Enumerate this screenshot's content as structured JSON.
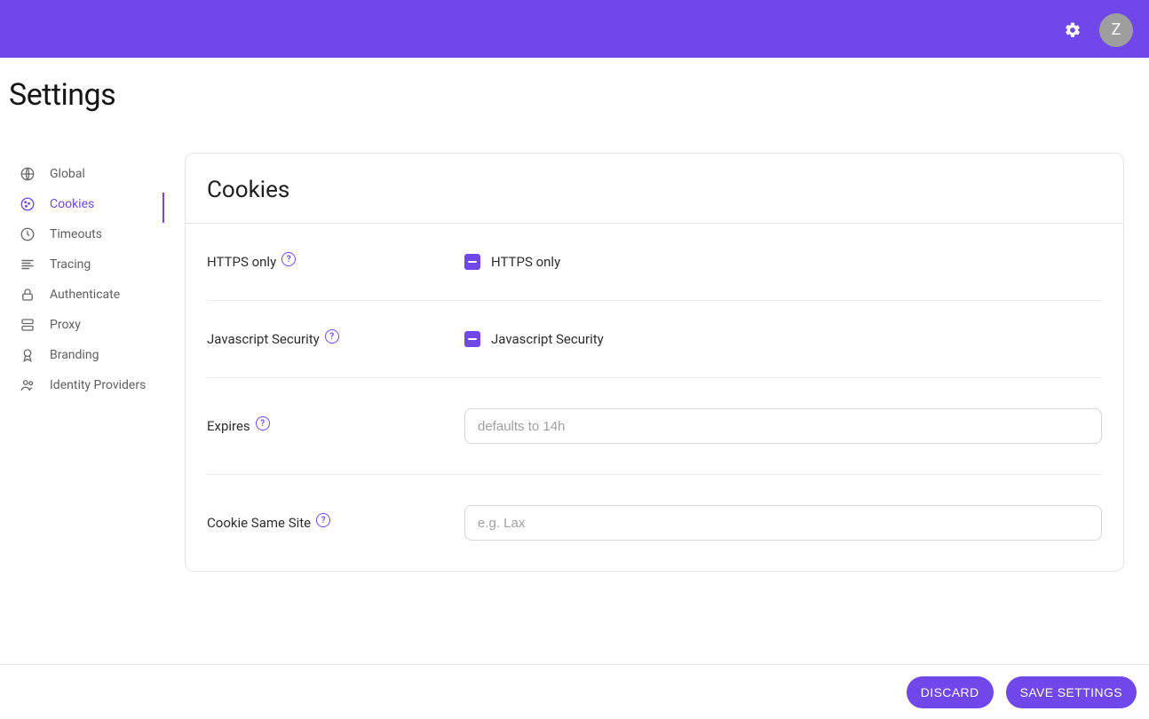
{
  "header": {
    "avatar_initial": "Z"
  },
  "page": {
    "title": "Settings"
  },
  "sidebar": {
    "items": [
      {
        "label": "Global"
      },
      {
        "label": "Cookies"
      },
      {
        "label": "Timeouts"
      },
      {
        "label": "Tracing"
      },
      {
        "label": "Authenticate"
      },
      {
        "label": "Proxy"
      },
      {
        "label": "Branding"
      },
      {
        "label": "Identity Providers"
      }
    ]
  },
  "card": {
    "title": "Cookies",
    "fields": {
      "https_only": {
        "label": "HTTPS only",
        "control_label": "HTTPS only"
      },
      "js_security": {
        "label": "Javascript Security",
        "control_label": "Javascript Security"
      },
      "expires": {
        "label": "Expires",
        "placeholder": "defaults to 14h",
        "value": ""
      },
      "same_site": {
        "label": "Cookie Same Site",
        "placeholder": "e.g. Lax",
        "value": ""
      }
    }
  },
  "footer": {
    "discard": "DISCARD",
    "save": "SAVE SETTINGS"
  }
}
